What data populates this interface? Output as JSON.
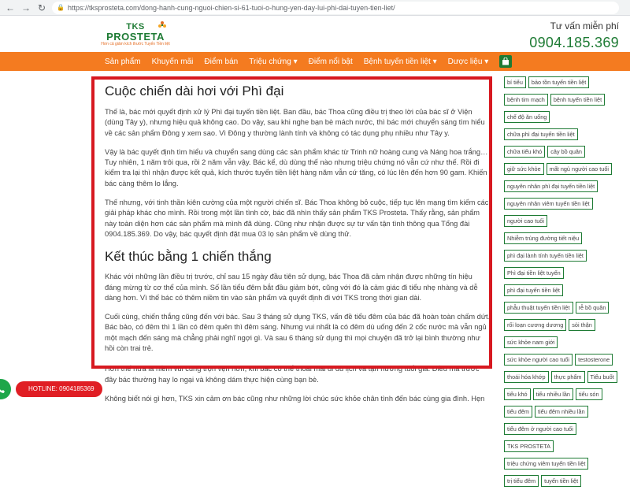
{
  "browser": {
    "url": "https://tksprosteta.com/dong-hanh-cung-nguoi-chien-si-61-tuoi-o-hung-yen-day-lui-phi-dai-tuyen-tien-liet/"
  },
  "header": {
    "logo_top": "TKS",
    "logo_main": "PROSTETA",
    "logo_tagline": "Hơn cả giảm kích thước Tuyến Tiền liệt",
    "hotline_title": "Tư vấn miễn phí",
    "hotline_number": "0904.185.369"
  },
  "nav": {
    "items": [
      "Sản phẩm",
      "Khuyến mãi",
      "Điểm bán",
      "Triệu chứng ▾",
      "Điểm nổi bật",
      "Bệnh tuyến tiền liệt ▾",
      "Dược liệu ▾"
    ]
  },
  "article": {
    "heading1": "Cuộc chiến dài hơi với Phì đại",
    "p1": "Thế là, bác mới quyết định xử lý Phì đại tuyến tiền liệt. Ban đầu, bác Thoa cũng điều trị theo lời của bác sĩ ở Viện (dùng Tây y), nhưng hiệu quả không cao. Do vậy, sau khi nghe bạn bè mách nước, thì bác mới chuyển sáng tìm hiểu về các sản phẩm Đông y xem sao. Vì Đông y thường lành tính và không có tác dụng phụ nhiều như Tây y.",
    "p2": "Vậy là bác quyết định tìm hiểu và chuyển sang dùng các sản phẩm khác từ Trinh nữ hoàng cung và Náng hoa trắng… Tuy nhiên, 1 năm trôi qua, rồi 2 năm vẫn vậy. Bác kể, dù dùng thế nào nhưng triệu chứng nó vẫn cứ như thế. Rồi đi kiểm tra lại thì nhận được kết quả, kích thước tuyến tiền liệt hàng năm vẫn cứ tăng, có lúc lên đến hơn 90 gam. Khiến bác càng thêm lo lắng.",
    "p3": "Thế nhưng, với tinh thần kiên cường của một người chiến sĩ. Bác Thoa không bỏ cuộc, tiếp tục lên mạng tìm kiếm các giải pháp khác cho mình. Rồi trong một lần tình cờ, bác đã nhìn thấy sản phẩm TKS Prosteta. Thấy rằng, sản phẩm này toàn diện hơn các sản phẩm mà mình đã dùng. Cũng như nhận được sự tư vấn tận tình thông qua Tổng đài 0904.185.369. Do vậy, bác quyết định đặt mua 03 lọ sản phẩm về dùng thử.",
    "heading2": "Kết thúc bằng 1 chiến thắng",
    "p4": "Khác với những lần điều trị trước, chỉ sau 15 ngày đầu tiên sử dụng, bác Thoa đã cảm nhận được những tín hiệu đáng mừng từ cơ thể của mình. Số lần tiểu đêm bắt đầu giảm bớt, cũng với đó là cảm giác đi tiểu nhẹ nhàng và dễ dàng hơn. Vì thế bác có thêm niềm tin vào sản phẩm và quyết định đi với TKS trong thời gian dài.",
    "p5": "Cuối cùng, chiến thắng cũng đến với bác. Sau 3 tháng sử dụng TKS, vấn đề tiểu đêm của bác đã hoàn toàn chấm dứt. Bác bảo, có đêm thì 1 lần có đêm quên thì đêm sáng. Nhưng vui nhất là có đêm dù uống đến 2 cốc nước mà vẫn ngủ một mạch đến sáng mà chẳng phải nghĩ ngợi gì. Và sau 6 tháng sử dụng thì mọi chuyện đã trở lại bình thường như hồi còn trai trẻ.",
    "p6": "Hơn thế nữa là niềm vui cũng trọn vẹn hơn, khi bác có thể thoải mái đi du lịch và tận hưởng tuổi già. Điều mà trước đây bác thường hay lo ngại và không dám thực hiện cùng bạn bè.",
    "p7": "Không biết nói gì hơn, TKS xin cảm ơn bác cũng như những lời chúc sức khỏe chân tình đến bác cùng gia đình. Hẹn"
  },
  "tags": [
    "bí tiểu",
    "bảo tồn tuyến tiền liệt",
    "bệnh tim mạch",
    "bệnh tuyến tiền liệt",
    "chế độ ăn uống",
    "chữa phì đại tuyến tiền liệt",
    "chữa tiểu khó",
    "cây bồ quân",
    "giữ sức khỏe",
    "mất ngủ người cao tuổi",
    "nguyên nhân phì đại tuyến tiền liệt",
    "nguyên nhân viêm tuyến tiền liệt",
    "người cao tuổi",
    "Nhiễm trùng đường tiết niệu",
    "phì đại lành tính tuyến tiền liệt",
    "Phì đại tiền liệt tuyến",
    "phì đại tuyến tiền liệt",
    "phẫu thuật tuyến tiền liệt",
    "rễ bồ quân",
    "rối loạn cương dương",
    "sỏi thận",
    "sức khỏe nam giới",
    "sức khỏe người cao tuổi",
    "testosterone",
    "thoái hóa khớp",
    "thực phẩm",
    "Tiểu buốt",
    "tiểu khó",
    "tiểu nhiều lần",
    "tiểu són",
    "tiểu đêm",
    "tiểu đêm nhiều lần",
    "tiểu đêm ở người cao tuổi",
    "TKS PROSTETA",
    "triệu chứng viêm tuyến tiền liệt",
    "trị tiểu đêm",
    "tuyến tiền liệt"
  ],
  "float": {
    "label": "HOTLINE: 0904185369"
  },
  "colors": {
    "brand_green": "#1e7b34",
    "nav_orange": "#f47b20",
    "highlight_red": "#d71920"
  }
}
